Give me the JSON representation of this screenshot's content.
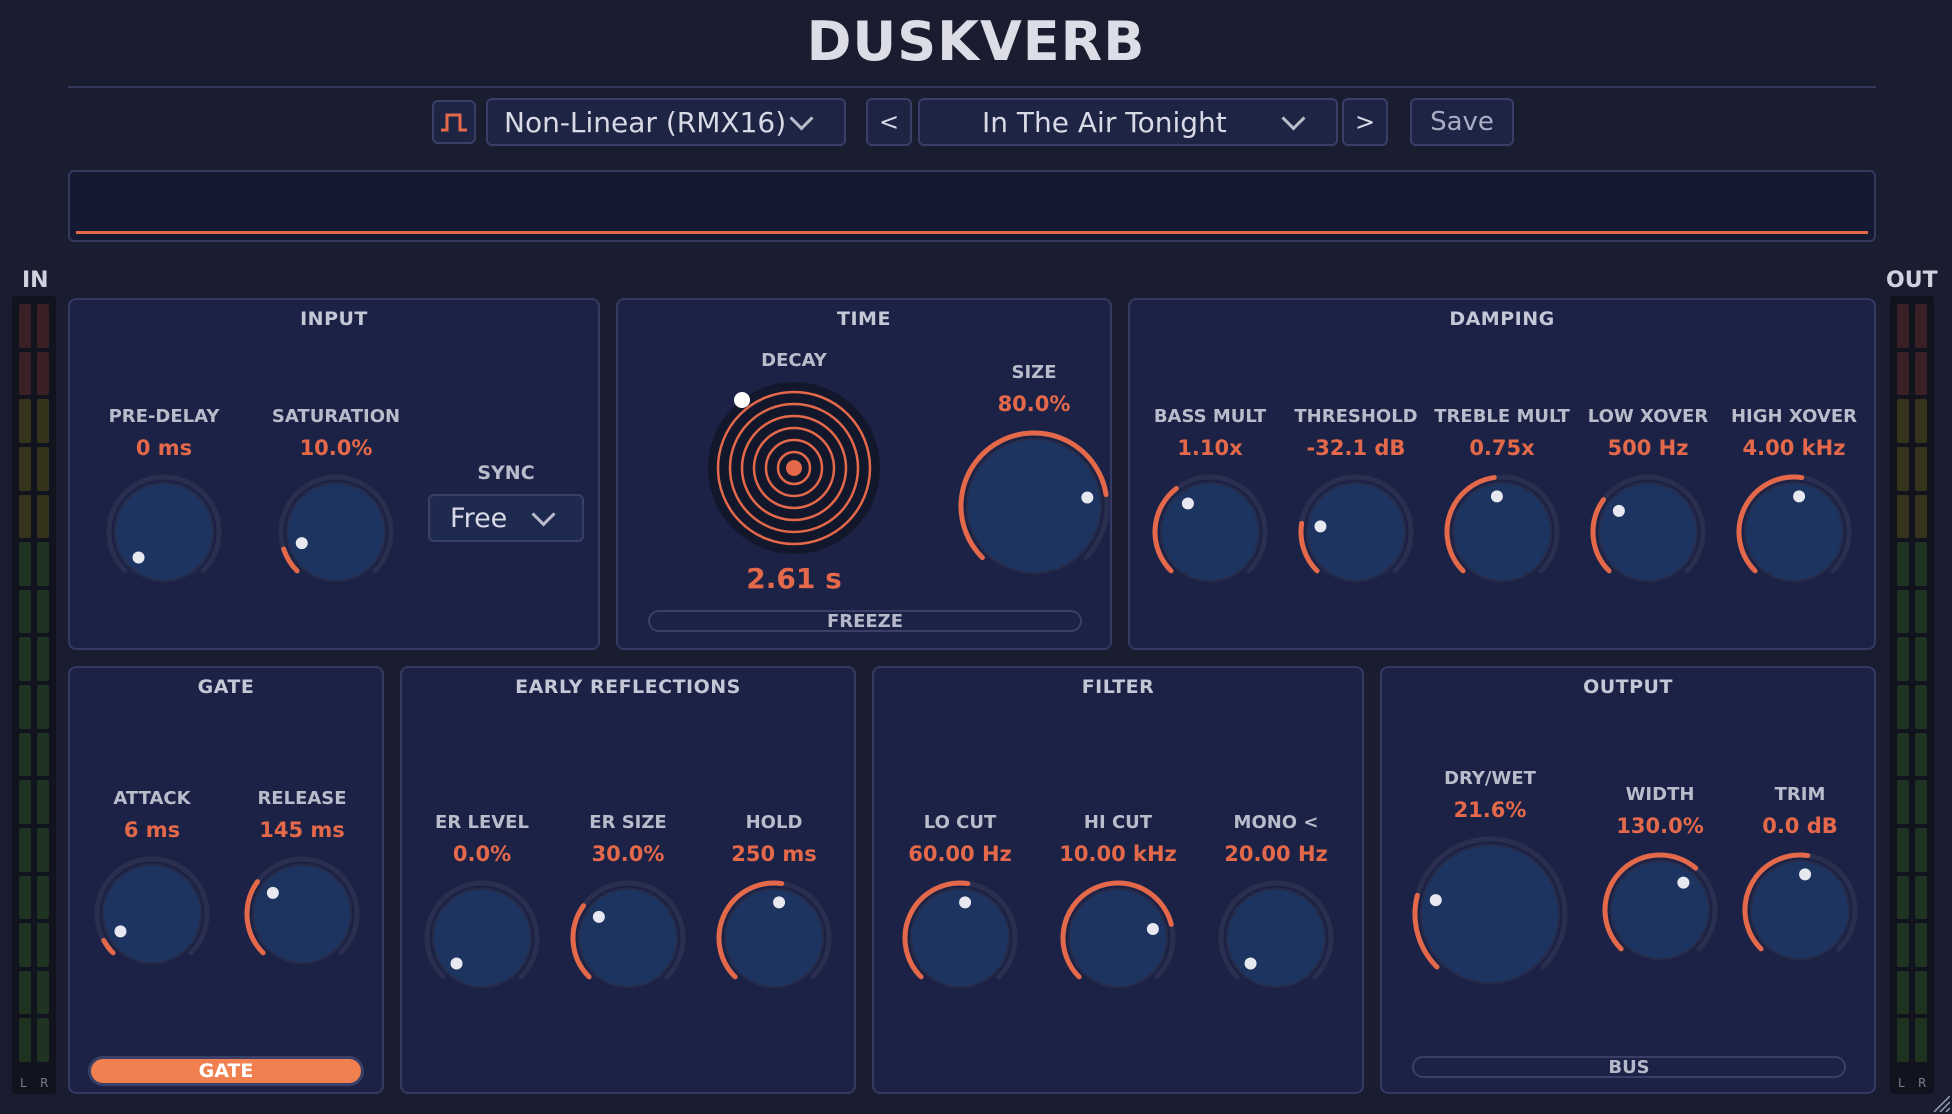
{
  "app": {
    "title": "DUSKVERB"
  },
  "toolbar": {
    "mode_icon": "gate-shape-icon",
    "algorithm": "Non-Linear (RMX16)",
    "prev_label": "<",
    "preset": "In The Air Tonight",
    "next_label": ">",
    "save_label": "Save"
  },
  "meters": {
    "in_label": "IN",
    "out_label": "OUT",
    "left": "L",
    "right": "R"
  },
  "colors": {
    "accent": "#e4694a",
    "panel": "#1c2245",
    "knob_fill": "#1d3461",
    "background": "#1a1c30",
    "gate_on": "#f08050"
  },
  "input": {
    "title": "INPUT",
    "pre_delay": {
      "label": "PRE-DELAY",
      "value": "0 ms",
      "level": 0.0
    },
    "saturation": {
      "label": "SATURATION",
      "value": "10.0%",
      "level": 0.1
    },
    "sync": {
      "label": "SYNC",
      "value": "Free"
    }
  },
  "time": {
    "title": "TIME",
    "decay": {
      "label": "DECAY",
      "value": "2.61 s"
    },
    "size": {
      "label": "SIZE",
      "value": "80.0%",
      "level": 0.8
    },
    "freeze_label": "FREEZE"
  },
  "damping": {
    "title": "DAMPING",
    "bass_mult": {
      "label": "BASS MULT",
      "value": "1.10x",
      "level": 0.36
    },
    "threshold": {
      "label": "THRESHOLD",
      "value": "-32.1 dB",
      "level": 0.2
    },
    "treble_mult": {
      "label": "TREBLE MULT",
      "value": "0.75x",
      "level": 0.47
    },
    "low_xover": {
      "label": "LOW XOVER",
      "value": "500 Hz",
      "level": 0.3
    },
    "high_xover": {
      "label": "HIGH XOVER",
      "value": "4.00 kHz",
      "level": 0.53
    }
  },
  "gate": {
    "title": "GATE",
    "attack": {
      "label": "ATTACK",
      "value": "6 ms",
      "level": 0.06
    },
    "release": {
      "label": "RELEASE",
      "value": "145 ms",
      "level": 0.3
    },
    "gate_label": "GATE"
  },
  "early_reflections": {
    "title": "EARLY REFLECTIONS",
    "er_level": {
      "label": "ER LEVEL",
      "value": "0.0%",
      "level": 0.0
    },
    "er_size": {
      "label": "ER SIZE",
      "value": "30.0%",
      "level": 0.3
    },
    "hold": {
      "label": "HOLD",
      "value": "250 ms",
      "level": 0.53
    }
  },
  "filter": {
    "title": "FILTER",
    "lo_cut": {
      "label": "LO CUT",
      "value": "60.00 Hz",
      "level": 0.53
    },
    "hi_cut": {
      "label": "HI CUT",
      "value": "10.00 kHz",
      "level": 0.78
    },
    "mono": {
      "label": "MONO <",
      "value": "20.00 Hz",
      "level": 0.0
    }
  },
  "output": {
    "title": "OUTPUT",
    "dry_wet": {
      "label": "DRY/WET",
      "value": "21.6%",
      "level": 0.22
    },
    "width": {
      "label": "WIDTH",
      "value": "130.0%",
      "level": 0.65
    },
    "trim": {
      "label": "TRIM",
      "value": "0.0 dB",
      "level": 0.53
    },
    "bus_label": "BUS"
  }
}
